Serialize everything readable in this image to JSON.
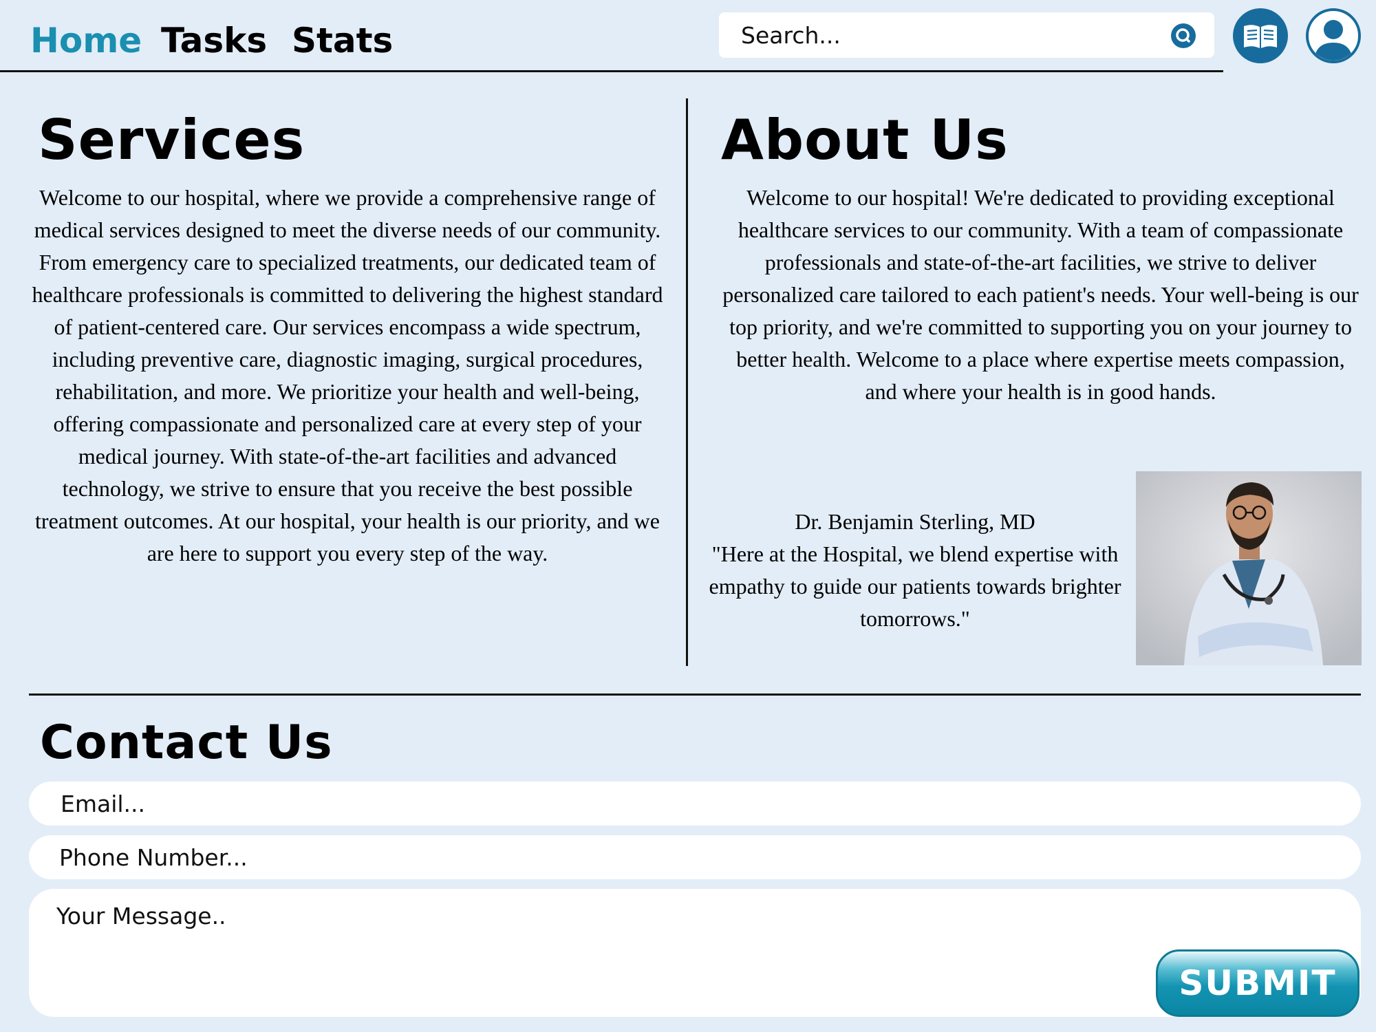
{
  "nav": {
    "links": [
      {
        "label": "Home"
      },
      {
        "label": "Tasks"
      },
      {
        "label": "Stats"
      }
    ],
    "accent_color": "#1a8fb0"
  },
  "search": {
    "placeholder": "Search...",
    "icon": "search-icon"
  },
  "header_icons": {
    "book": "book-icon",
    "profile": "user-avatar-icon",
    "icon_color": "#176c9d"
  },
  "services": {
    "title": "Services",
    "body": "Welcome to our hospital, where we provide a comprehensive range of medical services designed to meet the diverse needs of our community. From emergency care to specialized treatments, our dedicated team of healthcare professionals is committed to delivering the highest standard of patient-centered care. Our services encompass a wide spectrum, including preventive care, diagnostic imaging, surgical procedures, rehabilitation, and more. We prioritize your health and well-being, offering compassionate and personalized care at every step of your medical journey. With state-of-the-art facilities and advanced technology, we strive to ensure that you receive the best possible treatment outcomes. At our hospital, your health is our priority, and we are here to support you every step of the way."
  },
  "about": {
    "title": "About Us",
    "body": "Welcome to our hospital! We're dedicated to providing exceptional healthcare services to our community. With a team of compassionate professionals and state-of-the-art facilities, we strive to deliver personalized care tailored to each patient's needs. Your well-being is our top priority, and we're committed to supporting you on your journey to better health. Welcome to a place where expertise meets compassion, and where your health is in good hands.",
    "doctor_name": "Dr. Benjamin Sterling, MD",
    "doctor_quote": "\"Here at the Hospital, we blend expertise with empathy to guide our patients towards brighter tomorrows.\""
  },
  "contact": {
    "title": "Contact Us",
    "email_placeholder": "Email...",
    "phone_placeholder": "Phone Number...",
    "message_placeholder": "Your Message..",
    "submit_label": "SUBMIT"
  }
}
